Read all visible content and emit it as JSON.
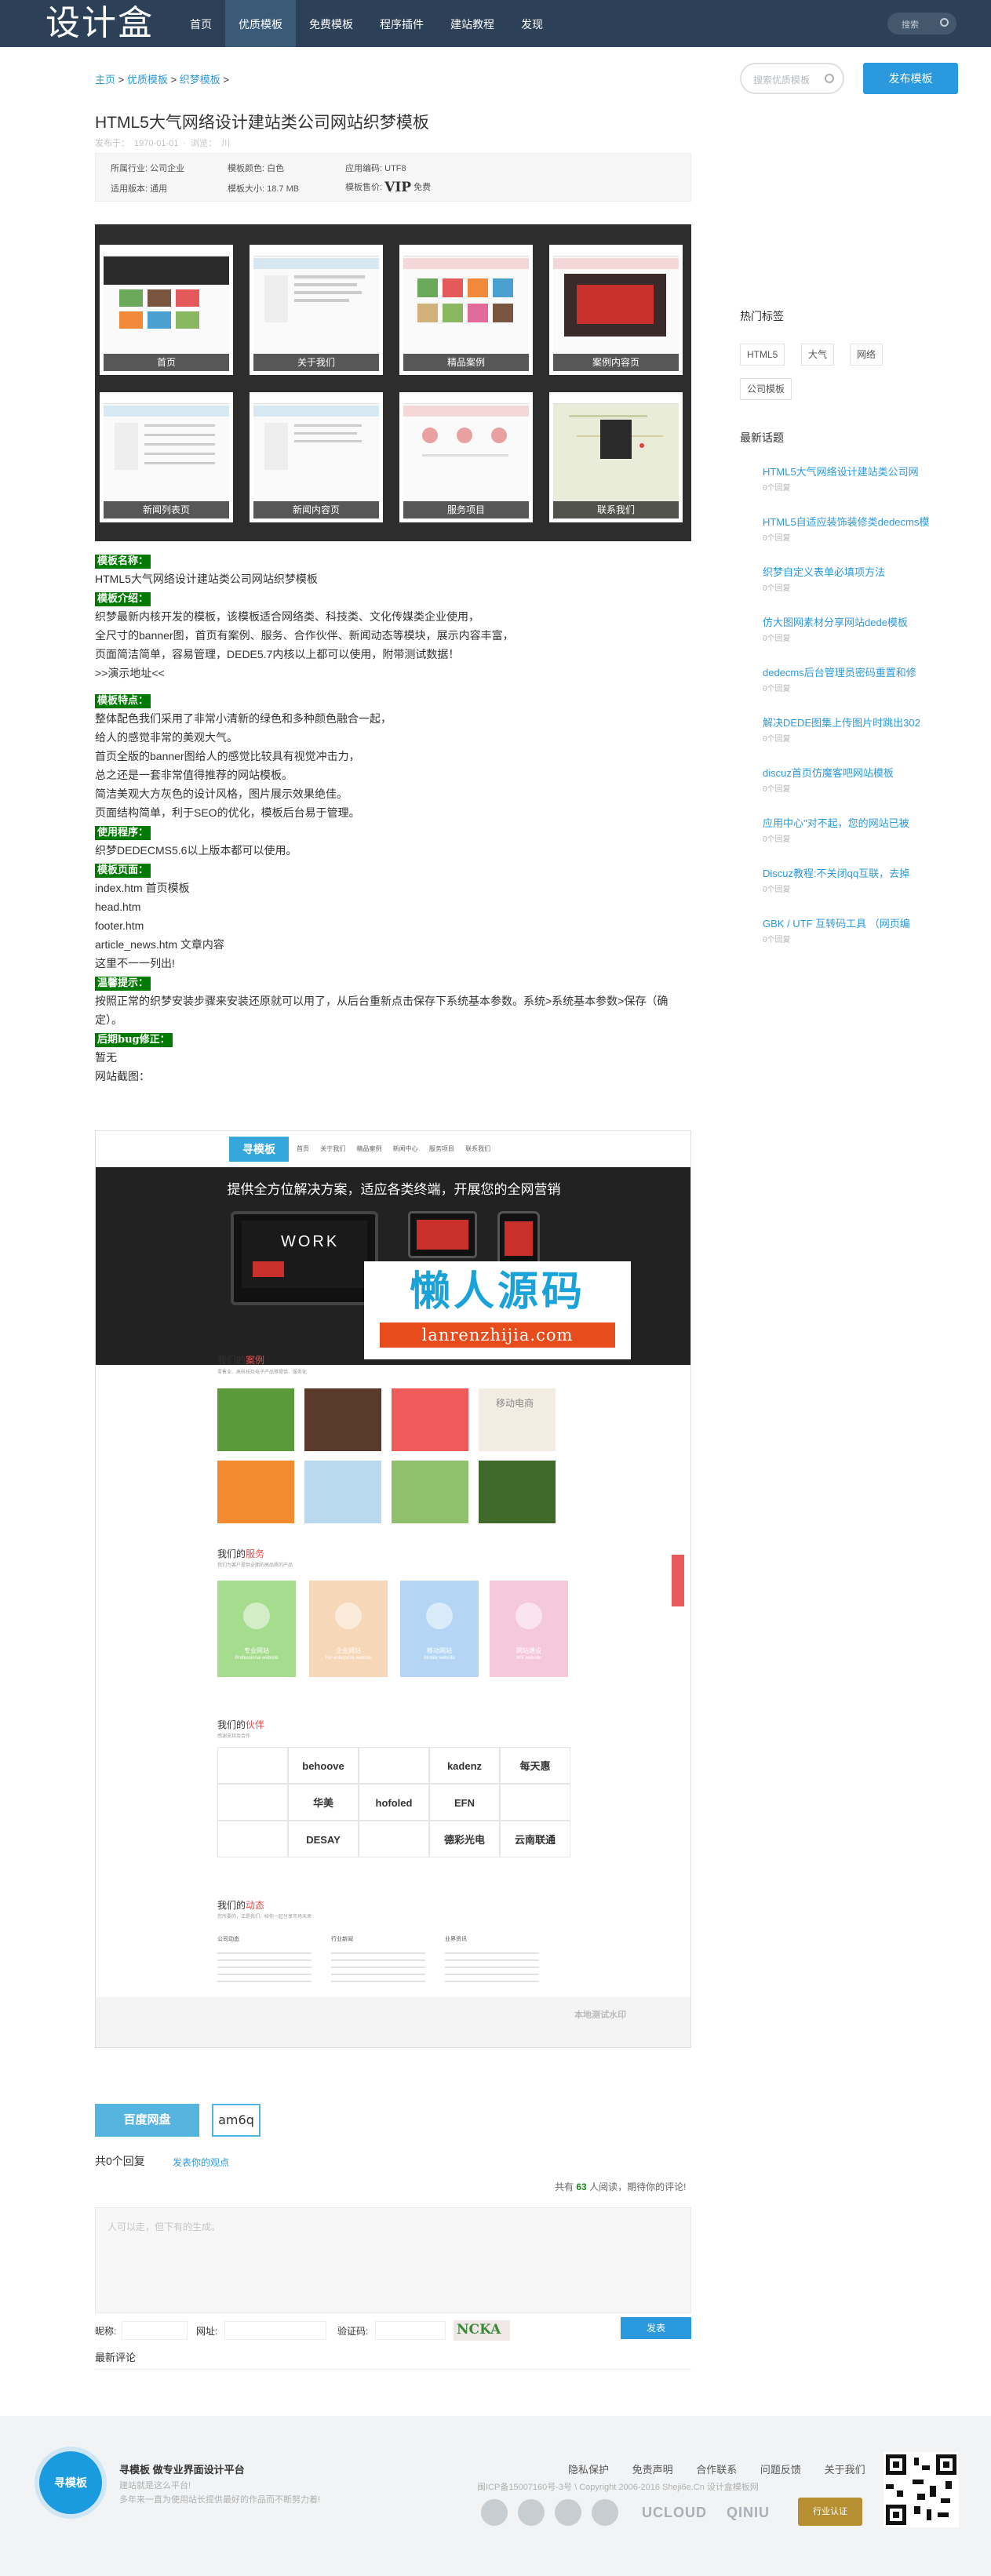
{
  "header": {
    "logo": "设计盒",
    "nav": [
      "首页",
      "优质模板",
      "免费模板",
      "程序插件",
      "建站教程",
      "发现"
    ],
    "active_nav": "优质模板",
    "search_placeholder": "搜索"
  },
  "breadcrumb": {
    "home": "主页",
    "sep": ">",
    "level1": "优质模板",
    "level2": "织梦模板"
  },
  "search_box": {
    "placeholder": "搜索优质模板"
  },
  "publish_button": "发布模板",
  "page": {
    "title": "HTML5大气网络设计建站类公司网站织梦模板",
    "meta": "发布于： 1970-01-01     · 浏览： 川"
  },
  "attributes": {
    "industry_label": "所属行业:",
    "industry": "公司企业",
    "color_label": "模板颜色:",
    "color": "白色",
    "encoding_label": "应用编码:",
    "encoding": "UTF8",
    "version_label": "适用版本:",
    "version": "通用",
    "size_label": "模板大小:",
    "size": "18.7 MB",
    "price_label": "模板售价:",
    "price_vip": "VIP",
    "price_note": "免费"
  },
  "gallery": [
    "首页",
    "关于我们",
    "精品案例",
    "案例内容页",
    "新闻列表页",
    "新闻内容页",
    "服务项目",
    "联系我们"
  ],
  "description": {
    "name_label": "模板名称：",
    "name": "HTML5大气网络设计建站类公司网站织梦模板",
    "intro_label": "模板介绍：",
    "intro": [
      "织梦最新内核开发的模板，该模板适合网络类、科技类、文化传媒类企业使用，",
      "全尺寸的banner图，首页有案例、服务、合作伙伴、新闻动态等模块，展示内容丰富，",
      "页面简洁简单，容易管理，DEDE5.7内核以上都可以使用，附带测试数据！",
      ">>演示地址<<"
    ],
    "feature_label": "模板特点：",
    "features": [
      "整体配色我们采用了非常小清新的绿色和多种颜色融合一起，",
      "给人的感觉非常的美观大气。",
      "首页全版的banner图给人的感觉比较具有视觉冲击力，",
      "总之还是一套非常值得推荐的网站模板。",
      "简洁美观大方灰色的设计风格，图片展示效果绝佳。",
      "页面结构简单，利于SEO的优化，模板后台易于管理。"
    ],
    "program_label": "使用程序：",
    "program": "织梦DEDECMS5.6以上版本都可以使用。",
    "pages_label": "模板页面：",
    "pages": [
      "index.htm 首页模板",
      "head.htm",
      "footer.htm",
      "article_news.htm 文章内容",
      "这里不一一列出!"
    ],
    "tips_label": "温馨提示：",
    "tips": "按照正常的织梦安装步骤来安装还原就可以用了，从后台重新点击保存下系统基本参数。系统>系统基本参数>保存（确定）。",
    "bug_label": "后期bug修正：",
    "bug": "暂无",
    "screenshot_label": "网站截图："
  },
  "screenshot": {
    "logo": "寻模板",
    "nav": "首页 关于我们 精品案例 新闻中心 服务项目 联系我们",
    "slogan": "提供全方位解决方案，适应各类终端，开展您的全网营销",
    "hero_word": "WORK",
    "watermark_cn": "懒人源码",
    "watermark_url": "lanrenzhijia.com",
    "cases_title_a": "我们的",
    "cases_title_b": "案例",
    "cases_sub": "零售业、高科技及电子产品等提供、服务化",
    "case_tile_text": "移动电商",
    "services_title_a": "我们的",
    "services_title_b": "服务",
    "services_sub": "我们为客户提供全面的高品质的产品",
    "services": [
      {
        "cn": "专业网站",
        "en": "Professional website"
      },
      {
        "cn": "企业网站",
        "en": "For enterprise website"
      },
      {
        "cn": "移动网站",
        "en": "Mobile website"
      },
      {
        "cn": "网站建设",
        "en": "WX website"
      }
    ],
    "partners_title_a": "我们的",
    "partners_title_b": "伙伴",
    "partners_sub": "感谢支持及合作",
    "partners": [
      "",
      "behoove",
      "",
      "kadenz",
      "每天惠",
      "",
      "华美",
      "hofoled",
      "EFN",
      "",
      "",
      "DESAY",
      "",
      "德彩光电",
      "云南联通"
    ],
    "news_title_a": "我们的",
    "news_title_b": "动态",
    "news_sub": "您所要的，正是我们，给你一起分享市场未来",
    "news_cols": [
      "公司动态",
      "行业新闻",
      "业界资讯"
    ],
    "footer_note": "本地测试水印"
  },
  "sidebar": {
    "tags_title": "热门标签",
    "tags": [
      "HTML5",
      "大气",
      "网络",
      "公司模板"
    ],
    "topics_title": "最新话题",
    "topics": [
      {
        "title": "HTML5大气网络设计建站类公司网",
        "count": "0个回复"
      },
      {
        "title": "HTML5自适应装饰装修类dedecms模",
        "count": "0个回复"
      },
      {
        "title": "织梦自定义表单必填项方法",
        "count": "0个回复"
      },
      {
        "title": "仿大图网素材分享网站dede模板",
        "count": "0个回复"
      },
      {
        "title": "dedecms后台管理员密码重置和修",
        "count": "0个回复"
      },
      {
        "title": "解决DEDE图集上传图片时跳出302",
        "count": "0个回复"
      },
      {
        "title": "discuz首页仿魔客吧网站模板",
        "count": "0个回复"
      },
      {
        "title": "应用中心\"对不起，您的网站已被",
        "count": "0个回复"
      },
      {
        "title": "Discuz教程:不关闭qq互联，去掉",
        "count": "0个回复"
      },
      {
        "title": "GBK / UTF 互转码工具 （网页编",
        "count": "0个回复"
      }
    ]
  },
  "download": {
    "button": "百度网盘",
    "code": "am6q"
  },
  "comments": {
    "count": "共0个回复",
    "post_link": "发表你的观点",
    "stat_prefix": "共有",
    "stat_num": "63",
    "stat_suffix": "人阅读，期待你的评论!",
    "placeholder": "人可以走，但下有的生成。",
    "nick_label": "昵称:",
    "url_label": "网址:",
    "captcha_label": "验证码:",
    "captcha_text": "NCKA",
    "send": "发表",
    "latest": "最新评论"
  },
  "footer": {
    "logo": "寻模板",
    "slogan": "寻模板  做专业界面设计平台",
    "line1": "建站就是这么平台!",
    "line2": "多年来一直为使用站长提供最好的作品而不断努力着!",
    "links": [
      "隐私保护",
      "免责声明",
      "合作联系",
      "问题反馈",
      "关于我们"
    ],
    "copyright": "闽ICP备15007160号-3号 \\ Copyright 2006-2016 Sheji6e.Cn 设计盒模板网",
    "brands": [
      "UCLOUD",
      "QINIU"
    ],
    "badge": "行业认证"
  }
}
